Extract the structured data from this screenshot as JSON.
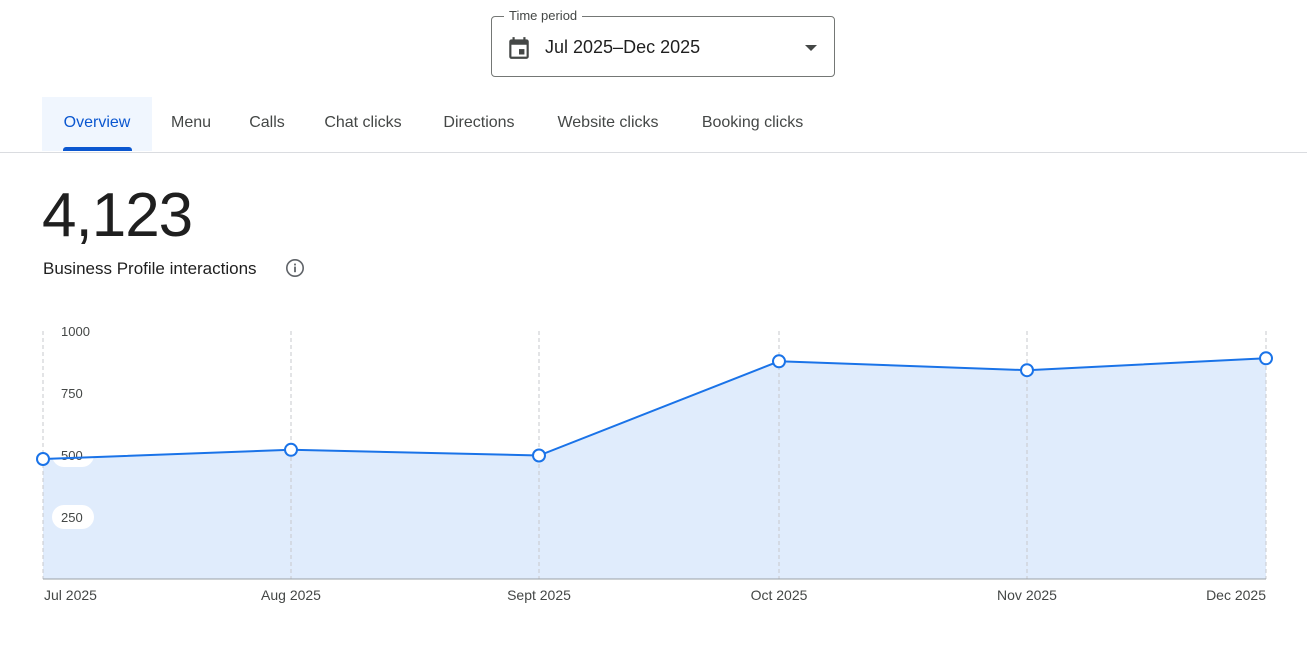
{
  "time_period": {
    "legend": "Time period",
    "value": "Jul 2025–Dec 2025",
    "icon": "calendar-icon"
  },
  "tabs": [
    {
      "label": "Overview",
      "active": true
    },
    {
      "label": "Menu"
    },
    {
      "label": "Calls"
    },
    {
      "label": "Chat clicks"
    },
    {
      "label": "Directions"
    },
    {
      "label": "Website clicks"
    },
    {
      "label": "Booking clicks"
    }
  ],
  "metric": {
    "value": "4,123",
    "label": "Business Profile interactions",
    "info_icon": "info-icon"
  },
  "colors": {
    "accent": "#0b57d0",
    "line": "#1a73e8",
    "area": "#e0ecfc"
  },
  "chart_data": {
    "type": "area",
    "x": [
      "Jul 2025",
      "Aug 2025",
      "Sept 2025",
      "Oct 2025",
      "Nov 2025",
      "Dec 2025"
    ],
    "series": [
      {
        "values": [
          484,
          521,
          498,
          878,
          842,
          890
        ]
      }
    ],
    "yticks": [
      250,
      500,
      750,
      1000
    ],
    "ylim": [
      0,
      1000
    ],
    "grid": "vertical dashed",
    "title": "",
    "xlabel": "",
    "ylabel": ""
  }
}
